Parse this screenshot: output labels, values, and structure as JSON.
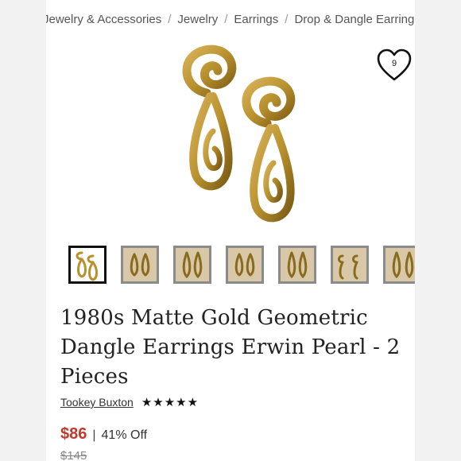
{
  "breadcrumb": {
    "items": [
      "Jewelry & Accessories",
      "Jewelry",
      "Earrings",
      "Drop & Dangle Earrings"
    ],
    "separator": "/"
  },
  "like": {
    "count": "9",
    "icon": "heart-icon"
  },
  "listing": {
    "title": "1980s Matte Gold Geometric Dangle Earrings Erwin Pearl - 2 Pieces",
    "seller": "Tookey Buxton",
    "rating_stars": "★★★★★",
    "price": "$86",
    "price_separator": "|",
    "discount": "41% Off",
    "original_price": "$145"
  },
  "thumbnails": {
    "count": 7,
    "active_index": 0
  },
  "colors": {
    "price": "#c0392b",
    "gold": "#b8912e",
    "gold_dark": "#7a5a14"
  }
}
